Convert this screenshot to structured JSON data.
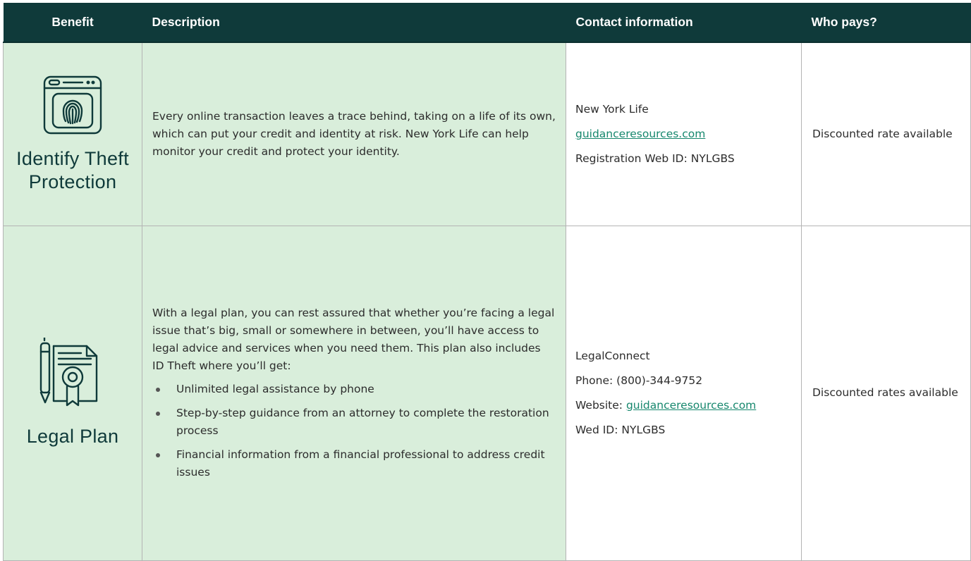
{
  "table": {
    "headers": {
      "benefit": "Benefit",
      "description": "Description",
      "contact": "Contact information",
      "who_pays": "Who pays?"
    },
    "rows": [
      {
        "benefit": "Identify Theft Protection",
        "icon": "fingerprint-browser-icon",
        "description": "Every online transaction leaves a trace behind, taking on a life of its own, which can put your credit and identity at risk. New York Life can help monitor your credit and protect your identity.",
        "contact": {
          "name": "New York Life",
          "link": "guidanceresources.com",
          "id_line": "Registration Web ID: NYLGBS"
        },
        "who_pays": "Discounted rate available"
      },
      {
        "benefit": "Legal Plan",
        "icon": "legal-certificate-icon",
        "description": "With a legal plan, you can rest assured that whether you’re facing a legal issue that’s big, small or somewhere in between, you’ll have access to legal advice and services when you need them. This plan also includes ID Theft where you’ll get:",
        "bullets": [
          "Unlimited legal assistance by phone",
          "Step-by-step guidance from an attorney to complete the restoration process",
          "Financial information from a financial professional to address credit issues"
        ],
        "contact": {
          "name": "LegalConnect",
          "phone": "Phone: (800)-344-9752",
          "website_label": "Website: ",
          "link": "guidanceresources.com",
          "id_line": "Wed ID: NYLGBS"
        },
        "who_pays": "Discounted rates available"
      }
    ]
  },
  "colors": {
    "header_bg": "#0f3a3a",
    "benefit_bg": "#d9eedb",
    "link": "#16876d",
    "accent_text": "#0f3a3a"
  }
}
